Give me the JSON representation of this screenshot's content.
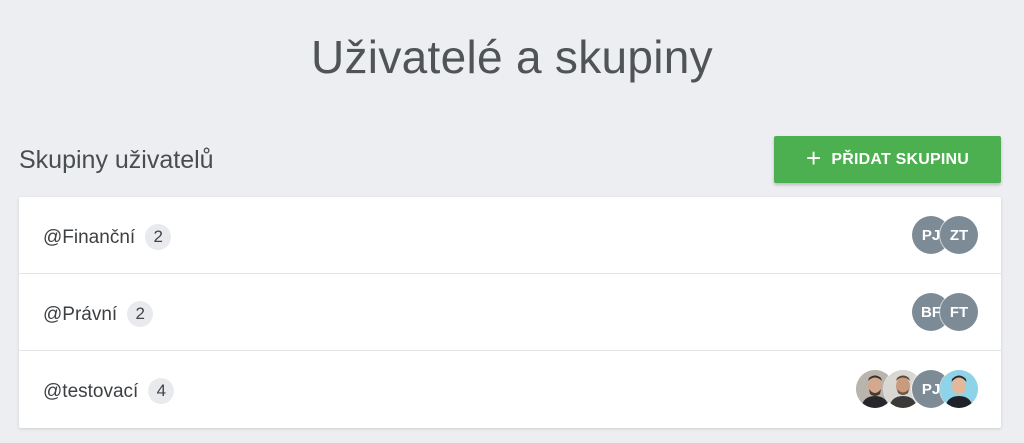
{
  "page": {
    "title": "Uživatelé a skupiny"
  },
  "section": {
    "title": "Skupiny uživatelů",
    "add_button_label": "PŘIDAT SKUPINU"
  },
  "groups": [
    {
      "name": "@Finanční",
      "count": "2",
      "members": [
        {
          "initials": "PJ",
          "type": "initials"
        },
        {
          "initials": "ZT",
          "type": "initials"
        }
      ]
    },
    {
      "name": "@Právní",
      "count": "2",
      "members": [
        {
          "initials": "BF",
          "type": "initials"
        },
        {
          "initials": "FT",
          "type": "initials"
        }
      ]
    },
    {
      "name": "@testovací",
      "count": "4",
      "members": [
        {
          "type": "photo"
        },
        {
          "type": "photo"
        },
        {
          "initials": "PJ",
          "type": "initials"
        },
        {
          "type": "photo"
        }
      ]
    }
  ],
  "colors": {
    "accent": "#4caf50",
    "background": "#eceef1",
    "avatar": "#7d8b96"
  }
}
